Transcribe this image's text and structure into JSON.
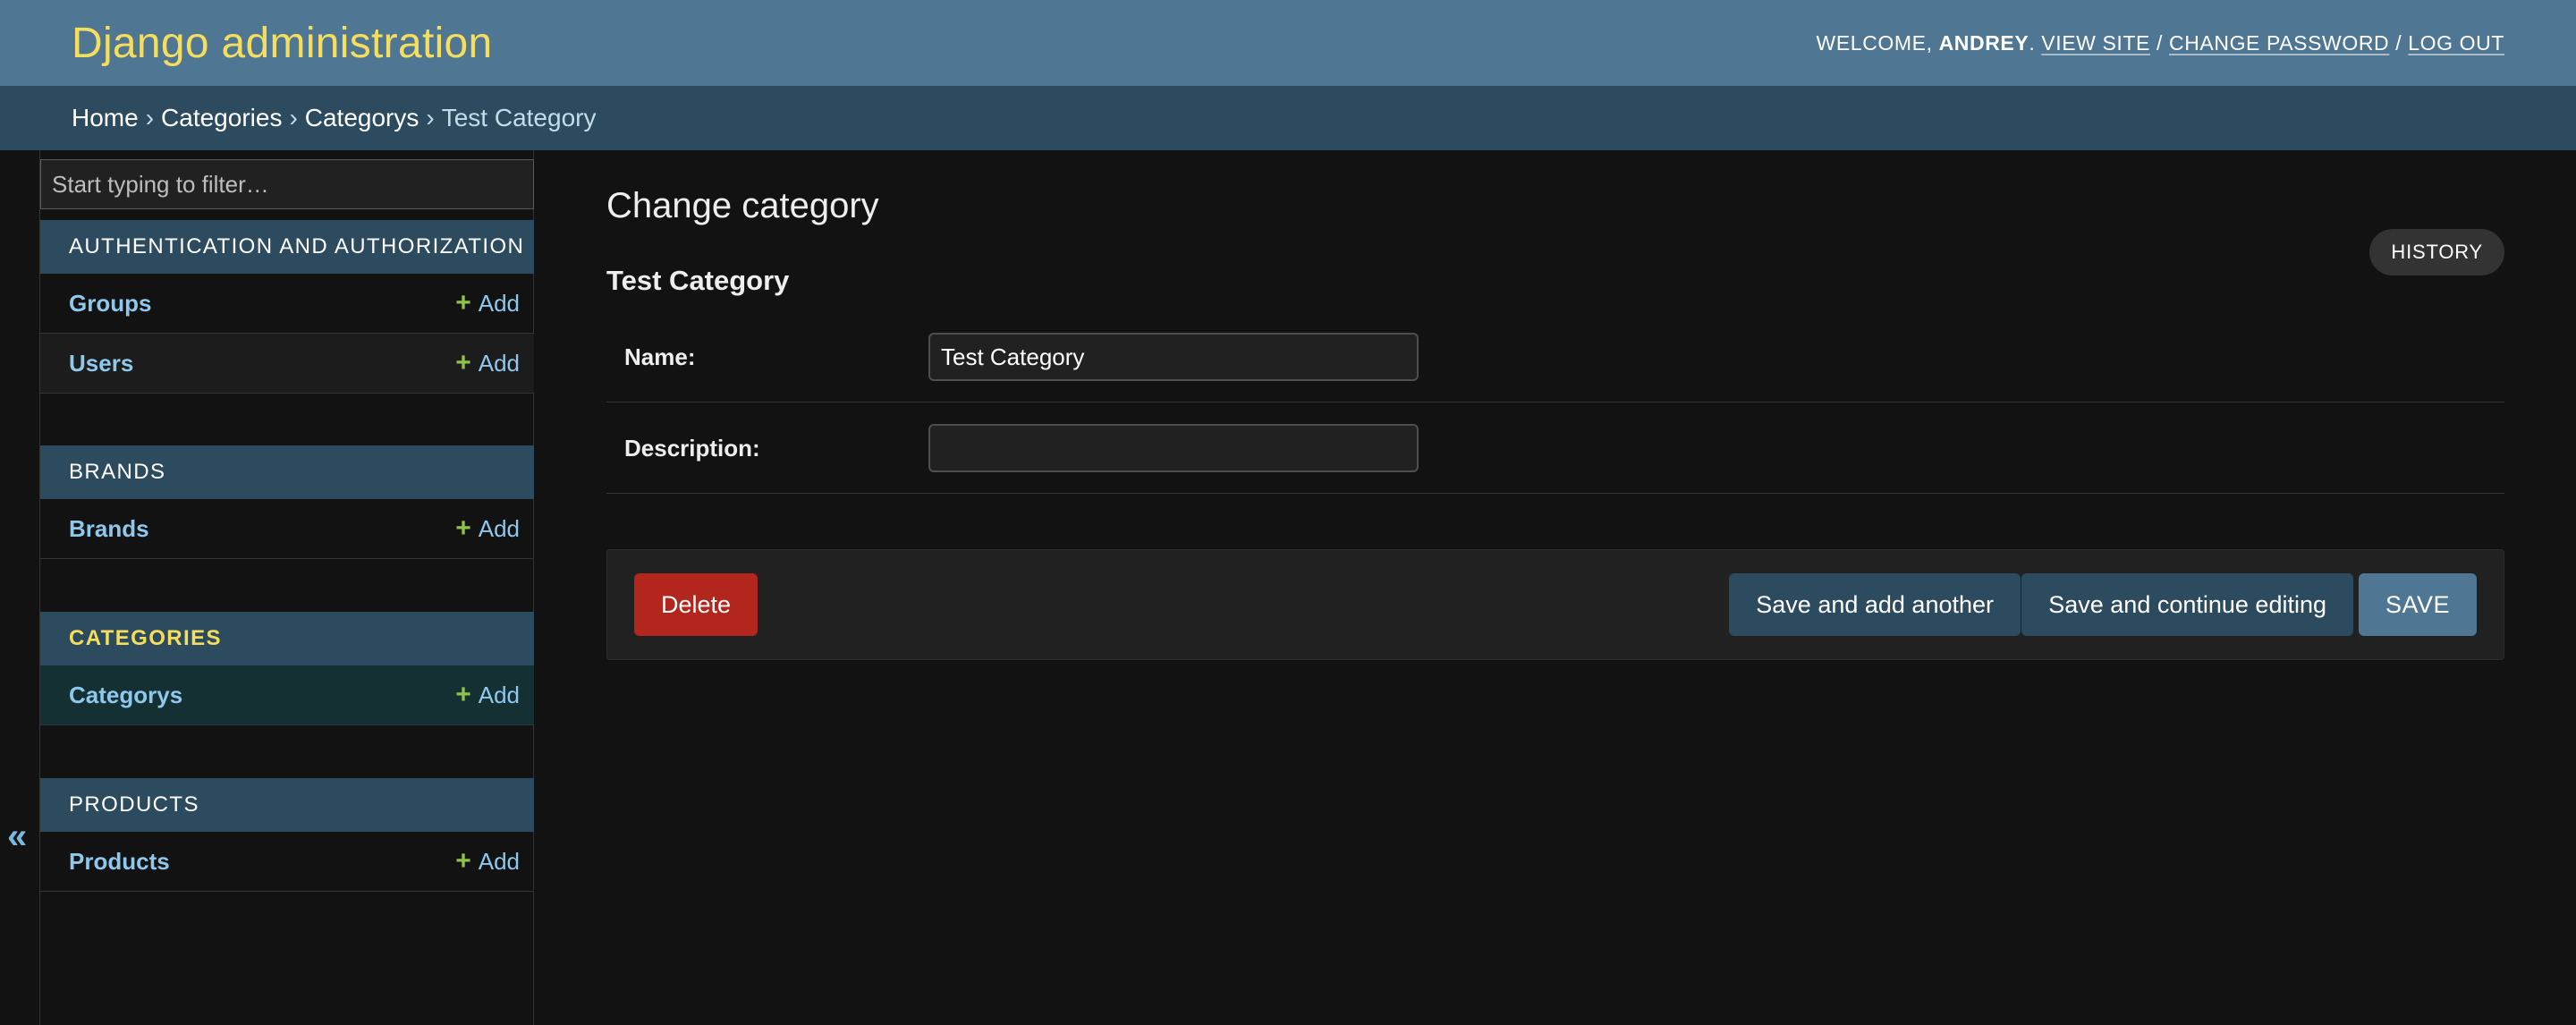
{
  "header": {
    "branding": "Django administration",
    "welcome": "WELCOME,",
    "username": "ANDREY",
    "view_site": "VIEW SITE",
    "change_password": "CHANGE PASSWORD",
    "log_out": "LOG OUT",
    "separator": "/"
  },
  "breadcrumbs": {
    "items": [
      "Home",
      "Categories",
      "Categorys",
      "Test Category"
    ],
    "separator": "›"
  },
  "sidebar": {
    "toggle_label": "«",
    "filter_placeholder": "Start typing to filter…",
    "apps": [
      {
        "caption": "Authentication and Authorization",
        "models": [
          {
            "name": "Groups",
            "add_label": "Add"
          },
          {
            "name": "Users",
            "add_label": "Add"
          }
        ]
      },
      {
        "caption": "Brands",
        "models": [
          {
            "name": "Brands",
            "add_label": "Add"
          }
        ]
      },
      {
        "caption": "Categories",
        "models": [
          {
            "name": "Categorys",
            "add_label": "Add"
          }
        ]
      },
      {
        "caption": "Products",
        "models": [
          {
            "name": "Products",
            "add_label": "Add"
          }
        ]
      }
    ]
  },
  "content": {
    "page_title": "Change category",
    "history_label": "History",
    "object_title": "Test Category",
    "fields": [
      {
        "label": "Name:",
        "value": "Test Category"
      },
      {
        "label": "Description:",
        "value": ""
      }
    ],
    "buttons": {
      "delete": "Delete",
      "save_add_another": "Save and add another",
      "save_continue": "Save and continue editing",
      "save": "SAVE"
    }
  },
  "colors": {
    "header_bg": "#4f7793",
    "branding": "#f5dd5d",
    "breadcrumbs_bg": "#2d4b5f",
    "link": "#8ec8ec",
    "add_icon": "#8fc24a",
    "delete_bg": "#b3261e",
    "page_bg": "#121212"
  }
}
